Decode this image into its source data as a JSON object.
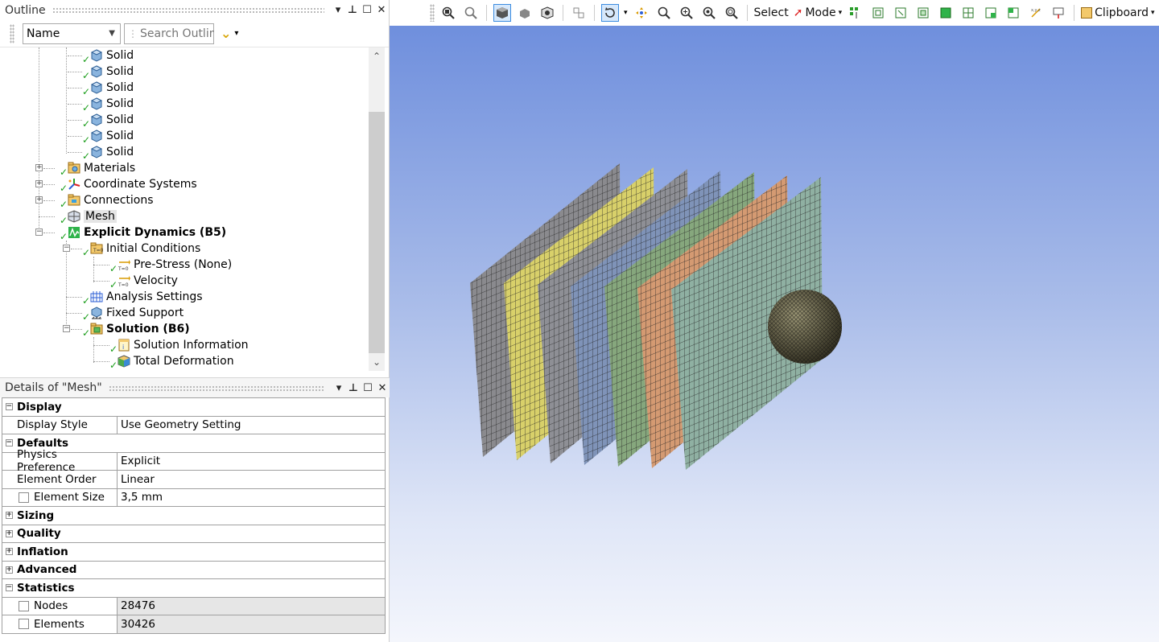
{
  "outline": {
    "title": "Outline",
    "filter_select": "Name",
    "search_placeholder": "Search Outline",
    "tree": [
      {
        "label": "Solid"
      },
      {
        "label": "Solid"
      },
      {
        "label": "Solid"
      },
      {
        "label": "Solid"
      },
      {
        "label": "Solid"
      },
      {
        "label": "Solid"
      },
      {
        "label": "Solid"
      },
      {
        "label": "Materials"
      },
      {
        "label": "Coordinate Systems"
      },
      {
        "label": "Connections"
      },
      {
        "label": "Mesh"
      },
      {
        "label": "Explicit Dynamics (B5)"
      },
      {
        "label": "Initial Conditions"
      },
      {
        "label": "Pre-Stress (None)"
      },
      {
        "label": "Velocity"
      },
      {
        "label": "Analysis Settings"
      },
      {
        "label": "Fixed Support"
      },
      {
        "label": "Solution (B6)"
      },
      {
        "label": "Solution Information"
      },
      {
        "label": "Total Deformation"
      }
    ]
  },
  "details": {
    "title": "Details of \"Mesh\"",
    "rows": [
      {
        "k": "Display"
      },
      {
        "k": "Display Style",
        "v": "Use Geometry Setting"
      },
      {
        "k": "Defaults"
      },
      {
        "k": "Physics Preference",
        "v": "Explicit"
      },
      {
        "k": "Element Order",
        "v": "Linear"
      },
      {
        "k": "Element Size",
        "v": "3,5 mm"
      },
      {
        "k": "Sizing"
      },
      {
        "k": "Quality"
      },
      {
        "k": "Inflation"
      },
      {
        "k": "Advanced"
      },
      {
        "k": "Statistics"
      },
      {
        "k": "Nodes",
        "v": "28476"
      },
      {
        "k": "Elements",
        "v": "30426"
      }
    ]
  },
  "toolbar": {
    "select_label": "Select",
    "mode_label": "Mode",
    "clipboard_label": "Clipboard"
  },
  "colors": {
    "viewport_top": "#6f8fdd",
    "viewport_bottom": "#f4f6fc",
    "check_green": "#1a9d1a",
    "plates": [
      "#8a8a8e",
      "#d8d06a",
      "#8e8f95",
      "#7f93b8",
      "#86a77d",
      "#d49a72",
      "#8fb0a2"
    ],
    "sphere": "#5c5840"
  }
}
